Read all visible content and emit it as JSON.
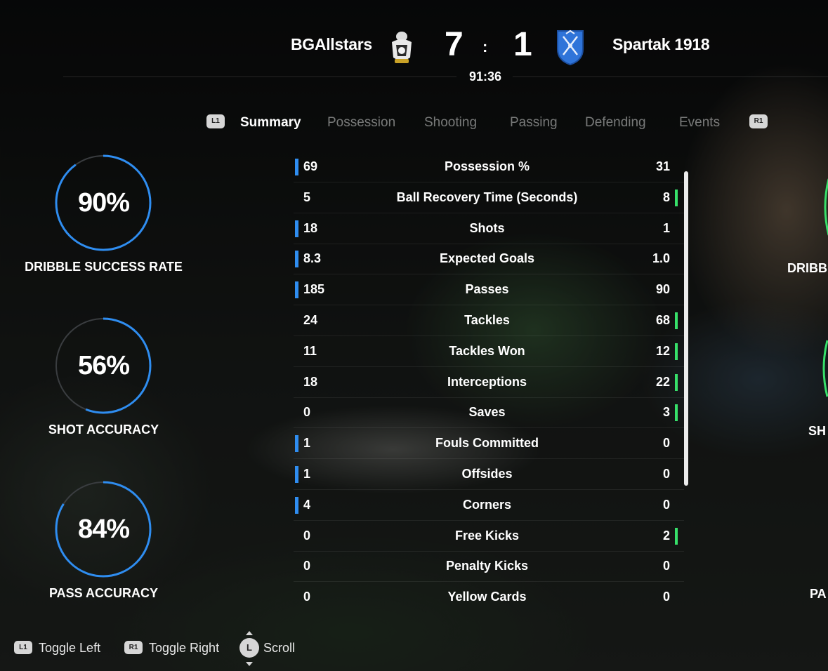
{
  "match": {
    "home_team": "BGAllstars",
    "away_team": "Spartak 1918",
    "home_score": "7",
    "separator": ":",
    "away_score": "1",
    "clock": "91:36"
  },
  "tabs": {
    "left_button": "L1",
    "right_button": "R1",
    "items": [
      "Summary",
      "Possession",
      "Shooting",
      "Passing",
      "Defending",
      "Events"
    ],
    "active": "Summary"
  },
  "home_rings": [
    {
      "value": "90%",
      "label": "DRIBBLE SUCCESS RATE",
      "fraction": 0.9
    },
    {
      "value": "56%",
      "label": "SHOT ACCURACY",
      "fraction": 0.56
    },
    {
      "value": "84%",
      "label": "PASS ACCURACY",
      "fraction": 0.84
    }
  ],
  "away_rings_cut": [
    "DRIBB",
    "SH",
    "PA"
  ],
  "stats": [
    {
      "name": "Possession %",
      "home": "69",
      "away": "31",
      "leader": "home"
    },
    {
      "name": "Ball Recovery Time (Seconds)",
      "home": "5",
      "away": "8",
      "leader": "away"
    },
    {
      "name": "Shots",
      "home": "18",
      "away": "1",
      "leader": "home"
    },
    {
      "name": "Expected Goals",
      "home": "8.3",
      "away": "1.0",
      "leader": "home"
    },
    {
      "name": "Passes",
      "home": "185",
      "away": "90",
      "leader": "home"
    },
    {
      "name": "Tackles",
      "home": "24",
      "away": "68",
      "leader": "away"
    },
    {
      "name": "Tackles Won",
      "home": "11",
      "away": "12",
      "leader": "away"
    },
    {
      "name": "Interceptions",
      "home": "18",
      "away": "22",
      "leader": "away"
    },
    {
      "name": "Saves",
      "home": "0",
      "away": "3",
      "leader": "away"
    },
    {
      "name": "Fouls Committed",
      "home": "1",
      "away": "0",
      "leader": "home"
    },
    {
      "name": "Offsides",
      "home": "1",
      "away": "0",
      "leader": "home"
    },
    {
      "name": "Corners",
      "home": "4",
      "away": "0",
      "leader": "home"
    },
    {
      "name": "Free Kicks",
      "home": "0",
      "away": "2",
      "leader": "away"
    },
    {
      "name": "Penalty Kicks",
      "home": "0",
      "away": "0",
      "leader": "none"
    },
    {
      "name": "Yellow Cards",
      "home": "0",
      "away": "0",
      "leader": "none"
    }
  ],
  "footer": {
    "toggle_left_button": "L1",
    "toggle_left": "Toggle Left",
    "toggle_right_button": "R1",
    "toggle_right": "Toggle Right",
    "scroll_button": "L",
    "scroll": "Scroll"
  },
  "colors": {
    "home_accent": "#2f8df0",
    "away_accent": "#37e06a",
    "ring_track": "#3a3d40"
  }
}
